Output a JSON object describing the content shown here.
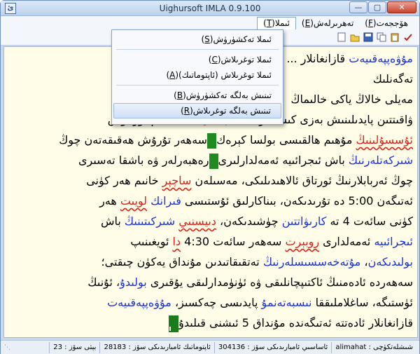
{
  "window": {
    "title": "Uighursoft IMLA 0.9.100",
    "icon_label": "ئ",
    "minimize": "—",
    "maximize": "▢",
    "close": "✕"
  },
  "menubar": {
    "items": [
      {
        "label": "ھۆججەت",
        "key": "F"
      },
      {
        "label": "تەھرىرلەش",
        "key": "E"
      },
      {
        "label": "ئىملا",
        "key": "T"
      }
    ]
  },
  "toolbar": {
    "icons": [
      "new-file-icon",
      "open-folder-icon",
      "save-icon",
      "copy-icon",
      "paste-icon",
      "spellcheck-icon"
    ]
  },
  "dropdown": {
    "items": [
      {
        "label": "ئىملا تەكشۈرۈش",
        "key": "S",
        "separator_after": true
      },
      {
        "label": "ئىملا توغرىلاش",
        "key": "C",
        "separator_after": false
      },
      {
        "label": "ئىملا توغرىلاش (ئاپتوماتىك)",
        "key": "A",
        "separator_after": true
      },
      {
        "label": "تىنىش بەلگە تەكشۈرۈش",
        "key": "B",
        "separator_after": false
      },
      {
        "label": "تىنىش بەلگە توغرىلاش",
        "key": "R",
        "separator_after": false,
        "highlight": true
      }
    ]
  },
  "editor": {
    "segments": [
      {
        "t": "مۇۋەپپەقىيەت",
        "c": "blue"
      },
      {
        "t": " قازانغانلار ... ",
        "c": ""
      },
      {
        "t": "\n",
        "c": ""
      },
      {
        "t": "                                              تەگەنلىك",
        "c": ""
      },
      {
        "t": "\nمەيلى خالاڭ ياكى خالىماڭ ",
        "c": ""
      },
      {
        "t": "\nۋاقىتتىن پايدىلىنىش بەزى كىشىلەرگە نىسبەتەن ... ساغلام تۇرمۇش",
        "c": ""
      },
      {
        "t": "\n",
        "c": ""
      },
      {
        "t": "ئۇسسۇلىنىڭ",
        "c": "red"
      },
      {
        "t": " مۇھىم ھالقىسى بولسا كېرەك",
        "c": ""
      },
      {
        "t": "GREEN",
        "c": ""
      },
      {
        "t": "سەھەر تۇرۇش ھەقىقەتەن چوڭ",
        "c": ""
      },
      {
        "t": "\n",
        "c": ""
      },
      {
        "t": "شىركەتلەرنىڭ",
        "c": "blue"
      },
      {
        "t": " باش ئىجرائىيە ئەمەلدارلىرى",
        "c": ""
      },
      {
        "t": "GREEN",
        "c": ""
      },
      {
        "t": "رەھبەرلەر ۋە باشقا تەسىرى",
        "c": ""
      },
      {
        "t": "\nچوڭ ئەربابلارنىڭ ئورتاق ئالاھىدىلىكى، مەسىلەن ",
        "c": ""
      },
      {
        "t": "ساچېر",
        "c": "red"
      },
      {
        "t": " خانىم ھەر كۈنى",
        "c": ""
      },
      {
        "t": "\nئەتىگەن 5:00 دە تۇرىدىكەن، بىناكارلىق ئۇستىسى ",
        "c": ""
      },
      {
        "t": "فىرانك",
        "c": "blue"
      },
      {
        "t": " ",
        "c": ""
      },
      {
        "t": "لويىت",
        "c": "red"
      },
      {
        "t": " ھەر",
        "c": ""
      },
      {
        "t": "\nكۈنى سائەت 4 تە ",
        "c": ""
      },
      {
        "t": "كارىۋاتتىن",
        "c": "blue"
      },
      {
        "t": " چۈشىدىكەن، ",
        "c": ""
      },
      {
        "t": "دىيسنىي",
        "c": "red"
      },
      {
        "t": " ",
        "c": ""
      },
      {
        "t": "شىركىتىنىڭ",
        "c": "blue"
      },
      {
        "t": " باش",
        "c": ""
      },
      {
        "t": "\n",
        "c": ""
      },
      {
        "t": "ئىجرائىيە",
        "c": "blue"
      },
      {
        "t": " ئەمەلدارى ",
        "c": ""
      },
      {
        "t": "روبېرت",
        "c": "red"
      },
      {
        "t": " سەھەر سائەت 4:30 ",
        "c": ""
      },
      {
        "t": "دا",
        "c": "red"
      },
      {
        "t": " ئويغىنىپ",
        "c": ""
      },
      {
        "t": "\n",
        "c": ""
      },
      {
        "t": "بولىدىكەن",
        "c": "blue"
      },
      {
        "t": "، ",
        "c": ""
      },
      {
        "t": "مۇتەخەسسىسلەرنىڭ",
        "c": "blue"
      },
      {
        "t": " تەتقىقاتىدىن مۇنداق يەكۈن چىقتى؛",
        "c": ""
      },
      {
        "t": "\nسەھەردە ئادەمنىڭ ئاكتىپچانلىقى ۋە ئۈنۈمدارلىقى يۇقىرى ",
        "c": ""
      },
      {
        "t": "بولىدۇ",
        "c": "blue"
      },
      {
        "t": "، ئۇنىڭ",
        "c": ""
      },
      {
        "t": "\nئۈستىگە، ساغلاملىققا ",
        "c": ""
      },
      {
        "t": "نىسبەتەنمۇ",
        "c": "blue"
      },
      {
        "t": " پايدىسى چەكسىز، ",
        "c": ""
      },
      {
        "t": "مۇۋەپپەقىيەت",
        "c": "blue"
      },
      {
        "t": "\nقازانغانلار ئادەتتە ئەتىگەندە مۇنداق 5 ئىشنى قىلىدۇ",
        "c": ""
      },
      {
        "t": "CURSOR",
        "c": ""
      }
    ]
  },
  "statusbar": {
    "cells": [
      {
        "label": "شىشلەتكۈچى",
        "value": "alimahat"
      },
      {
        "label": "ئاساسىي ئامبارىدىكى سۆز",
        "value": "304136"
      },
      {
        "label": "ئاپتوماتىك ئامبارىدىكى سۆز",
        "value": "28183"
      },
      {
        "label": "بېتى سۆز",
        "value": "23"
      }
    ]
  },
  "colors": {
    "highlight_blue": "#1a33d6",
    "error_red": "#d8231a",
    "marker_green": "#1f8a1f",
    "editor_bg": "#fffde7"
  }
}
